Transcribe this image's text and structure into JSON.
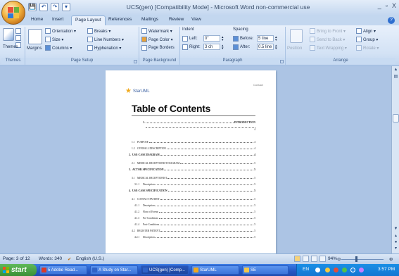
{
  "window": {
    "title": "UCS(gen) [Compatibility Mode] - Microsoft Word non-commercial use",
    "controls": [
      "_",
      "▫",
      "X"
    ]
  },
  "quick_access": [
    "💾",
    "↶",
    "↷",
    "▾"
  ],
  "tabs": [
    "Home",
    "Insert",
    "Page Layout",
    "References",
    "Mailings",
    "Review",
    "View"
  ],
  "active_tab": "Page Layout",
  "ribbon": {
    "themes": {
      "label": "Themes",
      "button": "Themes"
    },
    "page_setup": {
      "label": "Page Setup",
      "margins": "Margins",
      "orientation": "Orientation ▾",
      "size": "Size ▾",
      "columns": "Columns ▾",
      "breaks": "Breaks ▾",
      "line_numbers": "Line Numbers ▾",
      "hyphenation": "Hyphenation ▾"
    },
    "page_background": {
      "label": "Page Background",
      "watermark": "Watermark ▾",
      "page_color": "Page Color ▾",
      "page_borders": "Page Borders"
    },
    "paragraph": {
      "label": "Paragraph",
      "indent_heading": "Indent",
      "spacing_heading": "Spacing",
      "left_label": "Left:",
      "left_value": "0\"",
      "right_label": "Right:",
      "right_value": "3 ch",
      "before_label": "Before:",
      "before_value": "5 line",
      "after_label": "After:",
      "after_value": "0.5 line"
    },
    "arrange": {
      "label": "Arrange",
      "position": "Position",
      "bring_to_front": "Bring to Front ▾",
      "send_to_back": "Send to Back ▾",
      "text_wrapping": "Text Wrapping ▾",
      "align": "Align ▾",
      "group": "Group ▾",
      "rotate": "Rotate ▾"
    }
  },
  "document": {
    "logo_text": "StarUML",
    "page_tag": "Contact",
    "toc_title": "Table of Contents",
    "entries": [
      {
        "num": "1.",
        "text": "INTRODUCTION",
        "page": "4",
        "level": "top"
      },
      {
        "num": "1.1",
        "text": "PURPOSE",
        "page": "4",
        "level": "sub"
      },
      {
        "num": "1.2",
        "text": "OVERALL DESCRIPTION",
        "page": "4",
        "level": "sub"
      },
      {
        "num": "2.",
        "text": "USE-CASE DIAGRAM",
        "page": "4",
        "level": "main"
      },
      {
        "num": "2.1",
        "text": "MEDICAL RECEPTIONIST DIAGRAM",
        "page": "5",
        "level": "sub"
      },
      {
        "num": "3.",
        "text": "ACTOR SPECIFICATION",
        "page": "5",
        "level": "main"
      },
      {
        "num": "3.1",
        "text": "MEDICAL RECEPTIONIST",
        "page": "5",
        "level": "sub"
      },
      {
        "num": "3.1.1",
        "text": "Description",
        "page": "5",
        "level": "subsub"
      },
      {
        "num": "4.",
        "text": "USE-CASE SPECIFICATION",
        "page": "5",
        "level": "main"
      },
      {
        "num": "4.1",
        "text": "CONTACT PATIENT",
        "page": "5",
        "level": "sub"
      },
      {
        "num": "4.1.1",
        "text": "Description",
        "page": "5",
        "level": "subsub"
      },
      {
        "num": "4.1.2",
        "text": "Flow of Events",
        "page": "5",
        "level": "subsub"
      },
      {
        "num": "4.1.3",
        "text": "Pre-Conditions",
        "page": "5",
        "level": "subsub"
      },
      {
        "num": "4.1.4",
        "text": "Post-Conditions",
        "page": "5",
        "level": "subsub"
      },
      {
        "num": "4.2",
        "text": "REGISTER PATIENT",
        "page": "5",
        "level": "sub"
      },
      {
        "num": "4.2.1",
        "text": "Description",
        "page": "5",
        "level": "subsub"
      }
    ]
  },
  "statusbar": {
    "page": "Page: 3 of 12",
    "words": "Words: 340",
    "language": "English (U.S.)",
    "zoom": "94%"
  },
  "taskbar": {
    "start": "start",
    "tasks": [
      {
        "label": "5 Adobe Read...",
        "color": "#d93a2b"
      },
      {
        "label": "A Study on Star...",
        "color": "#2f63c8"
      },
      {
        "label": "UCS(gen) [Comp...",
        "color": "#2f63c8"
      },
      {
        "label": "StarUML",
        "color": "#f0a91c"
      },
      {
        "label": "SE",
        "color": "#f2c64a"
      }
    ],
    "lang": "EN",
    "time": "3:57 PM"
  }
}
